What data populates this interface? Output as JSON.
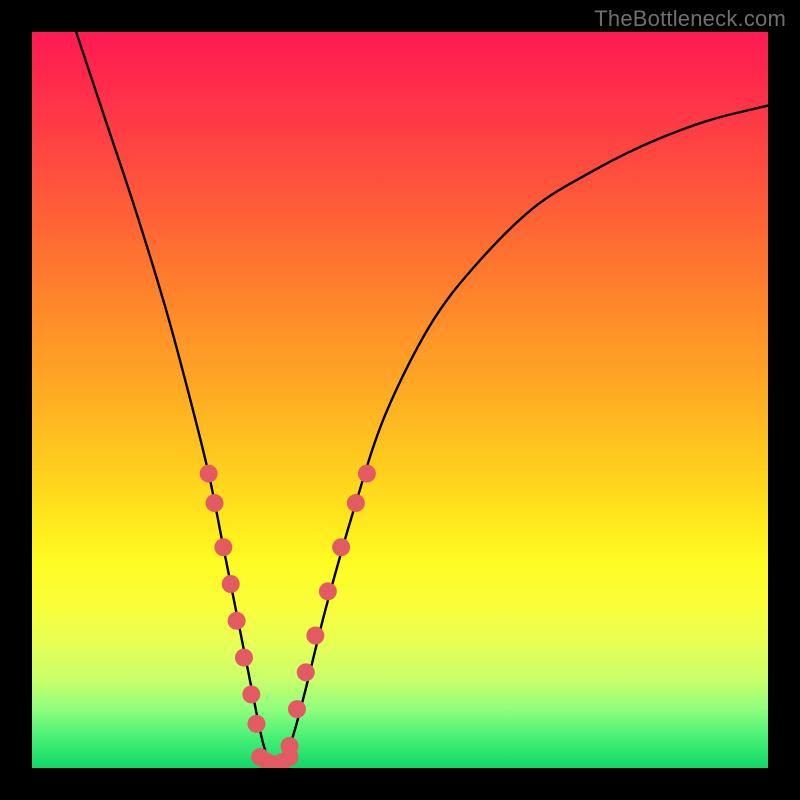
{
  "watermark": "TheBottleneck.com",
  "chart_data": {
    "type": "line",
    "title": "",
    "xlabel": "",
    "ylabel": "",
    "xlim": [
      0,
      100
    ],
    "ylim": [
      0,
      100
    ],
    "grid": false,
    "legend": false,
    "annotations": [],
    "background_gradient_stops": [
      {
        "pct": 0,
        "color": "#ff1a52"
      },
      {
        "pct": 50,
        "color": "#ffb020"
      },
      {
        "pct": 75,
        "color": "#fffb22"
      },
      {
        "pct": 92,
        "color": "#90ff7d"
      },
      {
        "pct": 100,
        "color": "#11d867"
      }
    ],
    "series": [
      {
        "name": "bottleneck-curve",
        "color": "#000000",
        "x": [
          6,
          10,
          14,
          18,
          21,
          24,
          26,
          28,
          30,
          31.5,
          33,
          35,
          37,
          40,
          44,
          48,
          54,
          60,
          68,
          76,
          84,
          92,
          100
        ],
        "y": [
          100,
          88,
          76,
          63,
          52,
          40,
          30,
          20,
          10,
          3,
          0,
          3,
          10,
          22,
          36,
          48,
          60,
          68,
          76,
          81,
          85,
          88,
          90
        ]
      }
    ],
    "markers": [
      {
        "name": "left-branch-dots",
        "color": "#e35b62",
        "shape": "circle",
        "radius_px": 9,
        "points": [
          {
            "x": 24.0,
            "y": 40
          },
          {
            "x": 24.8,
            "y": 36
          },
          {
            "x": 26.0,
            "y": 30
          },
          {
            "x": 27.0,
            "y": 25
          },
          {
            "x": 27.8,
            "y": 20
          },
          {
            "x": 28.8,
            "y": 15
          },
          {
            "x": 29.8,
            "y": 10
          },
          {
            "x": 30.5,
            "y": 6
          }
        ]
      },
      {
        "name": "right-branch-dots",
        "color": "#e35b62",
        "shape": "circle",
        "radius_px": 9,
        "points": [
          {
            "x": 35.0,
            "y": 3
          },
          {
            "x": 36.0,
            "y": 8
          },
          {
            "x": 37.2,
            "y": 13
          },
          {
            "x": 38.5,
            "y": 18
          },
          {
            "x": 40.2,
            "y": 24
          },
          {
            "x": 42.0,
            "y": 30
          },
          {
            "x": 44.0,
            "y": 36
          },
          {
            "x": 45.5,
            "y": 40
          }
        ]
      },
      {
        "name": "trough-dots",
        "color": "#e35b62",
        "shape": "circle",
        "radius_px": 9,
        "points": [
          {
            "x": 31.0,
            "y": 1.5
          },
          {
            "x": 32.0,
            "y": 0.8
          },
          {
            "x": 33.0,
            "y": 0.5
          },
          {
            "x": 34.0,
            "y": 0.8
          },
          {
            "x": 35.0,
            "y": 1.5
          }
        ]
      }
    ]
  }
}
